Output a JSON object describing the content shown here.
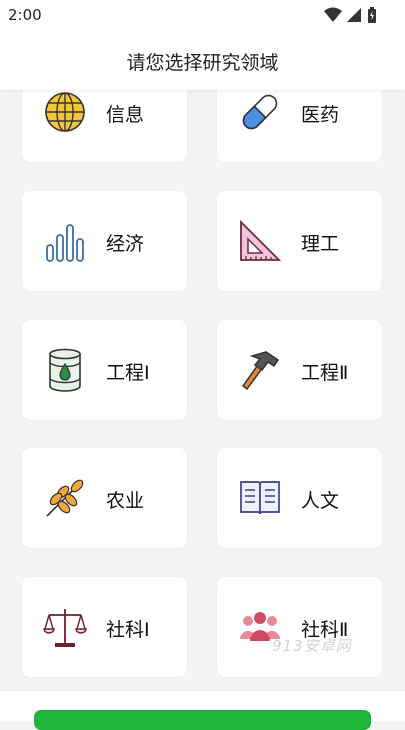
{
  "status_bar": {
    "time": "2:00"
  },
  "header": {
    "title": "请您选择研究领域"
  },
  "fields": [
    {
      "label": "信息",
      "icon": "globe-icon"
    },
    {
      "label": "医药",
      "icon": "pill-capsule-icon"
    },
    {
      "label": "经济",
      "icon": "bar-chart-icon"
    },
    {
      "label": "理工",
      "icon": "set-square-icon"
    },
    {
      "label": "工程Ⅰ",
      "icon": "oil-barrel-icon"
    },
    {
      "label": "工程Ⅱ",
      "icon": "hammer-icon"
    },
    {
      "label": "农业",
      "icon": "wheat-icon"
    },
    {
      "label": "人文",
      "icon": "open-book-icon"
    },
    {
      "label": "社科Ⅰ",
      "icon": "scales-icon"
    },
    {
      "label": "社科Ⅱ",
      "icon": "people-group-icon"
    }
  ],
  "watermark": "913安卓网",
  "colors": {
    "accent": "#1fb53a",
    "background": "#f4f4f4"
  }
}
